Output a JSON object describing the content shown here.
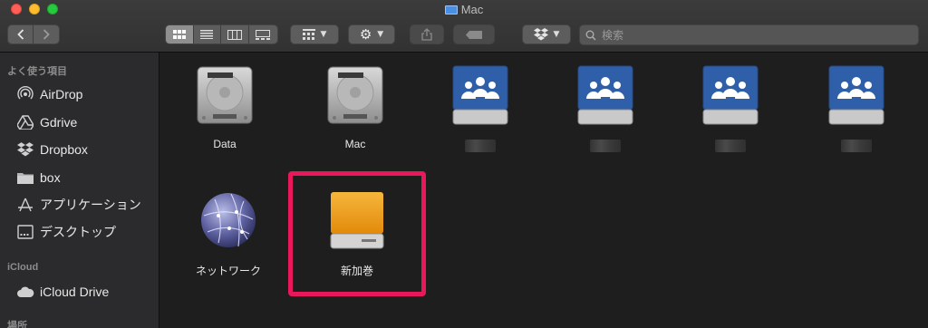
{
  "window": {
    "title": "Mac"
  },
  "toolbar": {
    "view_modes": [
      "icon-view",
      "list-view",
      "column-view",
      "gallery-view"
    ],
    "active_view": "icon-view",
    "search_placeholder": "検索"
  },
  "sidebar": {
    "favorites_header": "よく使う項目",
    "favorites": [
      {
        "label": "AirDrop",
        "icon": "airdrop-icon"
      },
      {
        "label": "Gdrive",
        "icon": "gdrive-icon"
      },
      {
        "label": "Dropbox",
        "icon": "dropbox-icon"
      },
      {
        "label": "box",
        "icon": "folder-icon"
      },
      {
        "label": "アプリケーション",
        "icon": "applications-icon"
      },
      {
        "label": "デスクトップ",
        "icon": "desktop-icon"
      }
    ],
    "icloud_header": "iCloud",
    "icloud": [
      {
        "label": "iCloud Drive",
        "icon": "icloud-icon"
      }
    ],
    "locations_header": "場所"
  },
  "content": {
    "items": [
      {
        "label": "Data",
        "icon": "internal-drive-icon"
      },
      {
        "label": "Mac",
        "icon": "internal-drive-icon"
      },
      {
        "label": "",
        "icon": "shared-server-icon"
      },
      {
        "label": "",
        "icon": "shared-server-icon"
      },
      {
        "label": "",
        "icon": "shared-server-icon"
      },
      {
        "label": "",
        "icon": "shared-server-icon"
      },
      {
        "label": "ネットワーク",
        "icon": "network-globe-icon"
      },
      {
        "label": "新加巻",
        "icon": "external-drive-icon"
      }
    ],
    "highlight_color": "#e8185a"
  }
}
